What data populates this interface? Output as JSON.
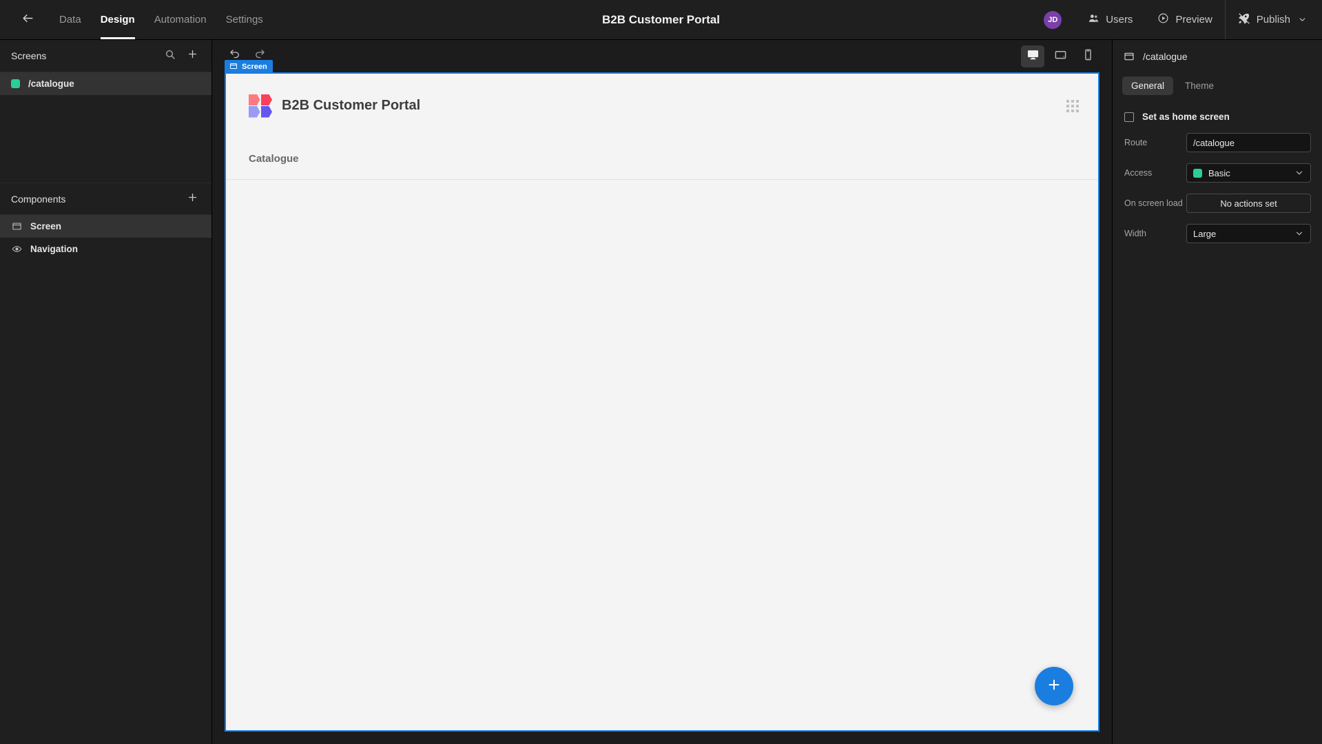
{
  "header": {
    "back_icon": "arrow-left-icon",
    "tabs": [
      {
        "label": "Data",
        "active": false
      },
      {
        "label": "Design",
        "active": true
      },
      {
        "label": "Automation",
        "active": false
      },
      {
        "label": "Settings",
        "active": false
      }
    ],
    "app_title": "B2B Customer Portal",
    "avatar_initials": "JD",
    "avatar_color": "#7b3fa8",
    "users_label": "Users",
    "preview_label": "Preview",
    "publish_label": "Publish"
  },
  "sidebar": {
    "screens": {
      "title": "Screens",
      "search_icon": "search-icon",
      "add_icon": "plus-icon",
      "items": [
        {
          "label": "/catalogue",
          "swatch_color": "#2dcc9a",
          "selected": true
        }
      ]
    },
    "components": {
      "title": "Components",
      "add_icon": "plus-icon",
      "items": [
        {
          "label": "Screen",
          "icon": "screen-icon",
          "selected": true
        },
        {
          "label": "Navigation",
          "icon": "eye-icon",
          "selected": false
        }
      ]
    }
  },
  "toolbar": {
    "undo_icon": "undo-icon",
    "redo_icon": "redo-icon",
    "devices": [
      {
        "name": "desktop",
        "active": true
      },
      {
        "name": "tablet",
        "active": false
      },
      {
        "name": "mobile",
        "active": false
      }
    ]
  },
  "canvas": {
    "badge_label": "Screen",
    "badge_color": "#1a7ee0",
    "app_brand": "B2B Customer Portal",
    "menu_items": [
      {
        "label": "Catalogue"
      }
    ],
    "grid_handle_icon": "grid-dots-icon",
    "fab_icon": "plus-icon",
    "fab_color": "#1a7ee0",
    "logo_colors": {
      "top_left": "#fd7b7e",
      "top_right": "#f9415a",
      "bottom_left": "#9a9bf4",
      "bottom_right": "#6457ef"
    }
  },
  "rightpanel": {
    "title": "/catalogue",
    "title_icon": "screen-icon",
    "tabs": [
      {
        "label": "General",
        "active": true
      },
      {
        "label": "Theme",
        "active": false
      }
    ],
    "home_screen_checkbox": {
      "label": "Set as home screen",
      "checked": false
    },
    "fields": {
      "route": {
        "label": "Route",
        "value": "/catalogue"
      },
      "access": {
        "label": "Access",
        "value": "Basic",
        "swatch_color": "#2dcc9a"
      },
      "on_screen_load": {
        "label": "On screen load",
        "value": "No actions set"
      },
      "width": {
        "label": "Width",
        "value": "Large"
      }
    }
  }
}
